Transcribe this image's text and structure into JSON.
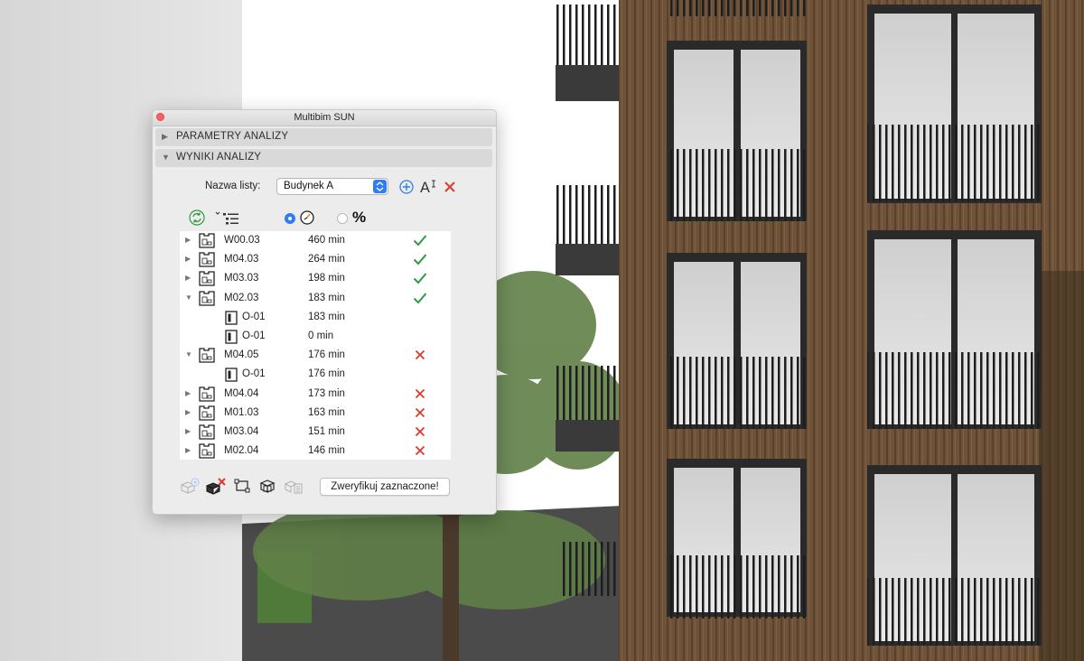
{
  "window": {
    "title": "Multibim SUN"
  },
  "sections": {
    "params": "PARAMETRY ANALIZY",
    "results": "WYNIKI ANALIZY"
  },
  "list": {
    "label": "Nazwa listy:",
    "selected": "Budynek A"
  },
  "options": {
    "percent_symbol": "%",
    "selected_mode": "minutes"
  },
  "rows": [
    {
      "name": "W00.03",
      "value": "460 min",
      "status": "ok",
      "expanded": false
    },
    {
      "name": "M04.03",
      "value": "264 min",
      "status": "ok",
      "expanded": false
    },
    {
      "name": "M03.03",
      "value": "198 min",
      "status": "ok",
      "expanded": false
    },
    {
      "name": "M02.03",
      "value": "183 min",
      "status": "ok",
      "expanded": true
    },
    {
      "name": "O-01",
      "value": "183 min",
      "child": true
    },
    {
      "name": "O-01",
      "value": "0 min",
      "child": true
    },
    {
      "name": "M04.05",
      "value": "176 min",
      "status": "fail",
      "expanded": true
    },
    {
      "name": "O-01",
      "value": "176 min",
      "child": true
    },
    {
      "name": "M04.04",
      "value": "173 min",
      "status": "fail",
      "expanded": false
    },
    {
      "name": "M01.03",
      "value": "163 min",
      "status": "fail",
      "expanded": false
    },
    {
      "name": "M03.04",
      "value": "151 min",
      "status": "fail",
      "expanded": false
    },
    {
      "name": "M02.04",
      "value": "146 min",
      "status": "fail",
      "expanded": false
    }
  ],
  "verify_button": "Zweryfikuj zaznaczone!",
  "colors": {
    "accent": "#2f7cf6",
    "ok": "#2d9c3c",
    "fail": "#e0392b"
  }
}
